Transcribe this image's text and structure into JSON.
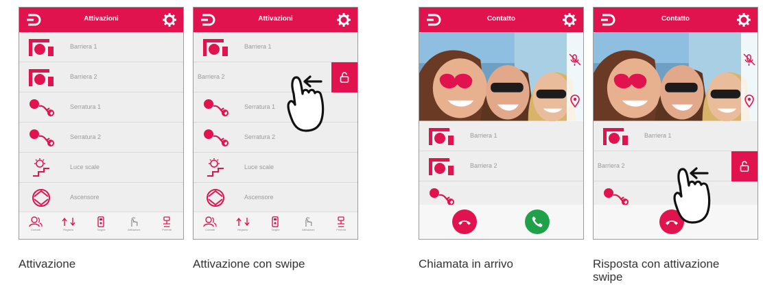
{
  "colors": {
    "accent": "#e0134f",
    "answer": "#21a04a",
    "hangup": "#e0134f"
  },
  "tabs": [
    "Contatti",
    "Registro",
    "Targhe",
    "Attivazioni",
    "Preferiti"
  ],
  "panels": [
    {
      "title": "Attivazioni",
      "items": [
        "Barriera 1",
        "Barriera 2",
        "Serratura 1",
        "Serratura 2",
        "Luce scale",
        "Ascensore"
      ],
      "caption": "Attivazione"
    },
    {
      "title": "Attivazioni",
      "items": [
        "Barriera 1",
        "Barriera 2",
        "Serratura 1",
        "Serratura 2",
        "Luce scale",
        "Ascensore"
      ],
      "caption": "Attivazione con swipe"
    },
    {
      "title": "Contatto",
      "items": [
        "Barriera 1",
        "Barriera 2"
      ],
      "caption": "Chiamata in arrivo"
    },
    {
      "title": "Contatto",
      "items": [
        "Barriera 1",
        "Barriera 2"
      ],
      "caption_line1": "Risposta con attivazione",
      "caption_line2": "swipe"
    }
  ],
  "icons": {
    "menu": "menu-back-icon",
    "settings": "gear-icon",
    "barrier": "barrier-icon",
    "key": "key-icon",
    "light": "stair-light-icon",
    "elevator": "elevator-icon",
    "lock": "unlock-icon",
    "hand": "swipe-hand-icon",
    "mic_off": "mic-off-icon",
    "pin": "location-pin-icon",
    "hangup": "hangup-icon",
    "answer": "phone-answer-icon"
  }
}
